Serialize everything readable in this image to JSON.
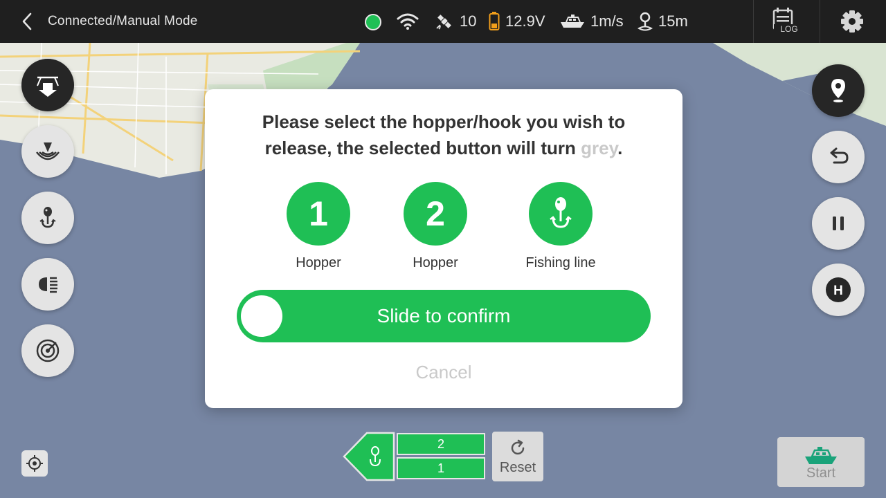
{
  "header": {
    "mode": "Connected/Manual Mode",
    "satellites": "10",
    "voltage": "12.9V",
    "speed": "1m/s",
    "distance": "15m",
    "log_label": "LOG"
  },
  "colors": {
    "accent_green": "#1fbf55",
    "topbar": "#1f1f1f",
    "water": "#7786a3",
    "land": "#e9eae2",
    "battery": "#f29f1b"
  },
  "left_buttons": [
    "drop-bait-icon",
    "sonar-icon",
    "fishing-hook-icon",
    "headlight-icon",
    "radar-icon"
  ],
  "right_buttons": [
    "location-pin-icon",
    "undo-icon",
    "pause-icon",
    "home-icon"
  ],
  "right_button_labels": {
    "home": "H"
  },
  "dialog": {
    "title_main": "Please select the hopper/hook you wish to release, the selected button will turn ",
    "title_grey": "grey",
    "title_end": ".",
    "choices": [
      {
        "number": "1",
        "label": "Hopper"
      },
      {
        "number": "2",
        "label": "Hopper"
      },
      {
        "number": "",
        "label": "Fishing line"
      }
    ],
    "slide_label": "Slide to confirm",
    "cancel_label": "Cancel"
  },
  "bottom": {
    "slot_top": "2",
    "slot_bottom": "1",
    "reset_label": "Reset",
    "start_label": "Start"
  }
}
